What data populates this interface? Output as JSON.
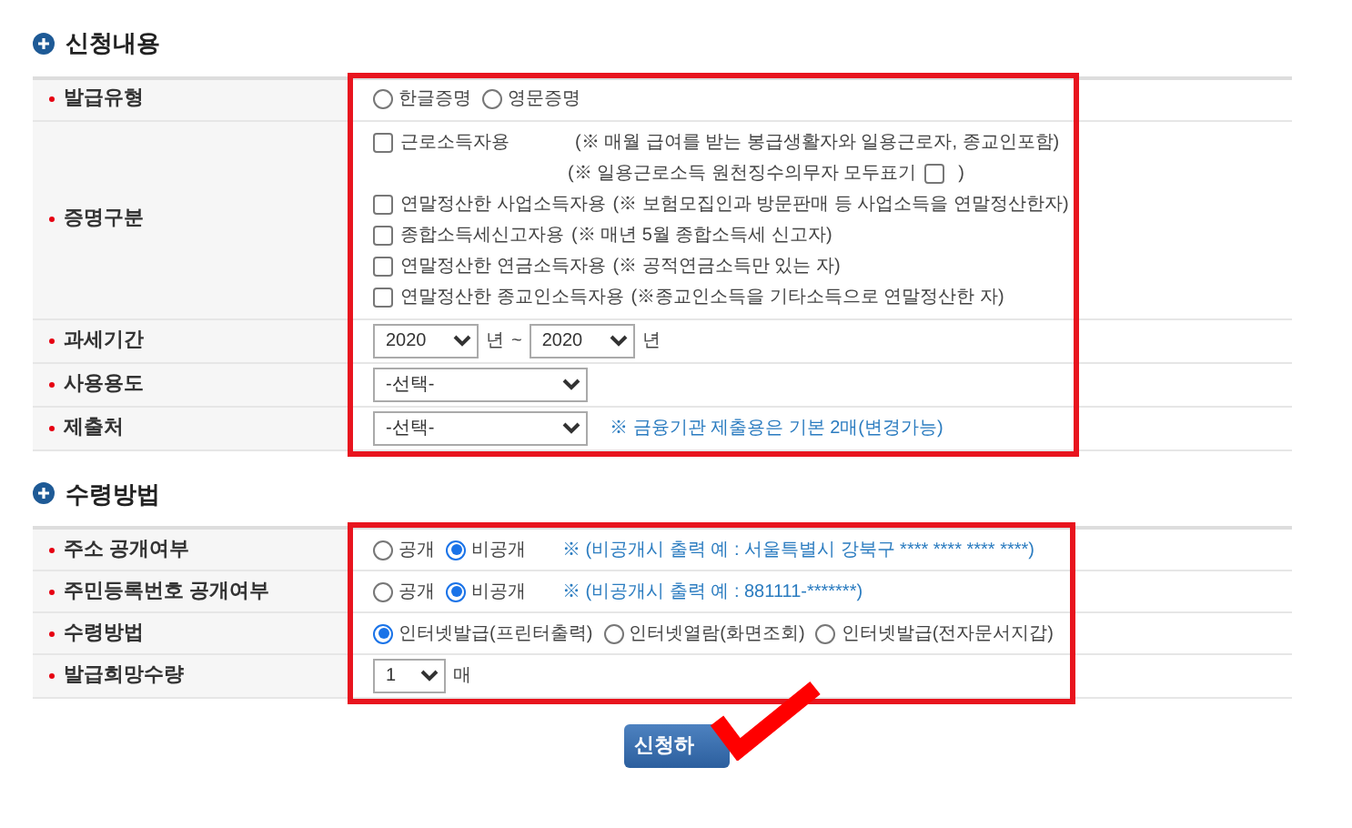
{
  "sections": [
    {
      "title": "신청내용",
      "rows": [
        {
          "label": "발급유형",
          "kind": "radios",
          "options": [
            {
              "label": "한글증명",
              "selected": false
            },
            {
              "label": "영문증명",
              "selected": false
            }
          ]
        },
        {
          "label": "증명구분",
          "kind": "checkboxes",
          "items": [
            {
              "label": "근로소득자용",
              "checked": false,
              "note": "(※ 매월 급여를 받는 봉급생활자와 일용근로자, 종교인포함)",
              "extra": {
                "before": "(※ 일용근로소득 원천징수의무자 모두표기",
                "checked": false,
                "after": ")"
              }
            },
            {
              "label": "연말정산한 사업소득자용",
              "checked": false,
              "note": "(※ 보험모집인과 방문판매 등 사업소득을 연말정산한자)"
            },
            {
              "label": "종합소득세신고자용",
              "checked": false,
              "note": "(※ 매년 5월 종합소득세 신고자)"
            },
            {
              "label": "연말정산한 연금소득자용",
              "checked": false,
              "note": "(※ 공적연금소득만 있는 자)"
            },
            {
              "label": "연말정산한 종교인소득자용",
              "checked": false,
              "note": "(※종교인소득을 기타소득으로 연말정산한 자)"
            }
          ]
        },
        {
          "label": "과세기간",
          "kind": "year_range",
          "from": "2020",
          "from_unit": "년",
          "sep": "~",
          "to": "2020",
          "to_unit": "년"
        },
        {
          "label": "사용용도",
          "kind": "select",
          "value": "-선택-"
        },
        {
          "label": "제출처",
          "kind": "select",
          "value": "-선택-",
          "note": "※ 금융기관 제출용은 기본 2매(변경가능)"
        }
      ]
    },
    {
      "title": "수령방법",
      "rows": [
        {
          "label": "주소 공개여부",
          "kind": "radios",
          "options": [
            {
              "label": "공개",
              "selected": false
            },
            {
              "label": "비공개",
              "selected": true
            }
          ],
          "note": "※ (비공개시 출력 예 : 서울특별시 강북구 **** **** **** ****)"
        },
        {
          "label": "주민등록번호 공개여부",
          "kind": "radios",
          "options": [
            {
              "label": "공개",
              "selected": false
            },
            {
              "label": "비공개",
              "selected": true
            }
          ],
          "note": "※ (비공개시 출력 예 : 881111-*******)"
        },
        {
          "label": "수령방법",
          "kind": "radios",
          "options": [
            {
              "label": "인터넷발급(프린터출력)",
              "selected": true
            },
            {
              "label": "인터넷열람(화면조회)",
              "selected": false
            },
            {
              "label": "인터넷발급(전자문서지갑)",
              "selected": false
            }
          ]
        },
        {
          "label": "발급희망수량",
          "kind": "quantity",
          "value": "1",
          "unit": "매"
        }
      ]
    }
  ],
  "submit": {
    "label": "신청하"
  }
}
